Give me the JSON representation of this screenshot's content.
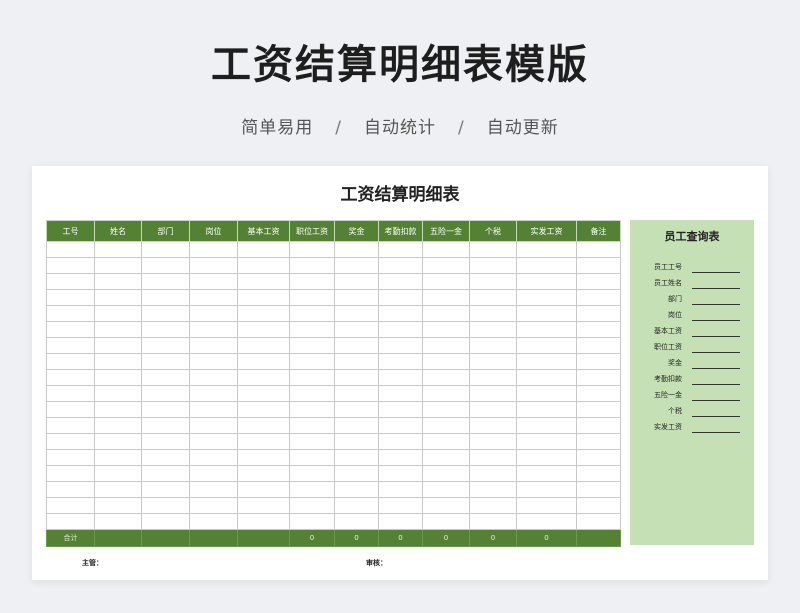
{
  "hero": {
    "title": "工资结算明细表模版",
    "taglines": [
      "简单易用",
      "自动统计",
      "自动更新"
    ],
    "separator": "/"
  },
  "sheet": {
    "title": "工资结算明细表",
    "columns": [
      "工号",
      "姓名",
      "部门",
      "岗位",
      "基本工资",
      "职位工资",
      "奖金",
      "考勤扣款",
      "五险一金",
      "个税",
      "实发工资",
      "备注"
    ],
    "empty_row_count": 18,
    "total_row": [
      "合计",
      "",
      "",
      "",
      "",
      "0",
      "0",
      "0",
      "0",
      "0",
      "0",
      ""
    ],
    "header_color": "#548235"
  },
  "lookup": {
    "title": "员工查询表",
    "fields": [
      "员工工号",
      "员工姓名",
      "部门",
      "岗位",
      "基本工资",
      "职位工资",
      "奖金",
      "考勤扣款",
      "五险一金",
      "个税",
      "实发工资"
    ],
    "background_color": "#c5e0b4"
  },
  "footer": {
    "supervisor_label": "主管：",
    "reviewer_label": "审核："
  }
}
